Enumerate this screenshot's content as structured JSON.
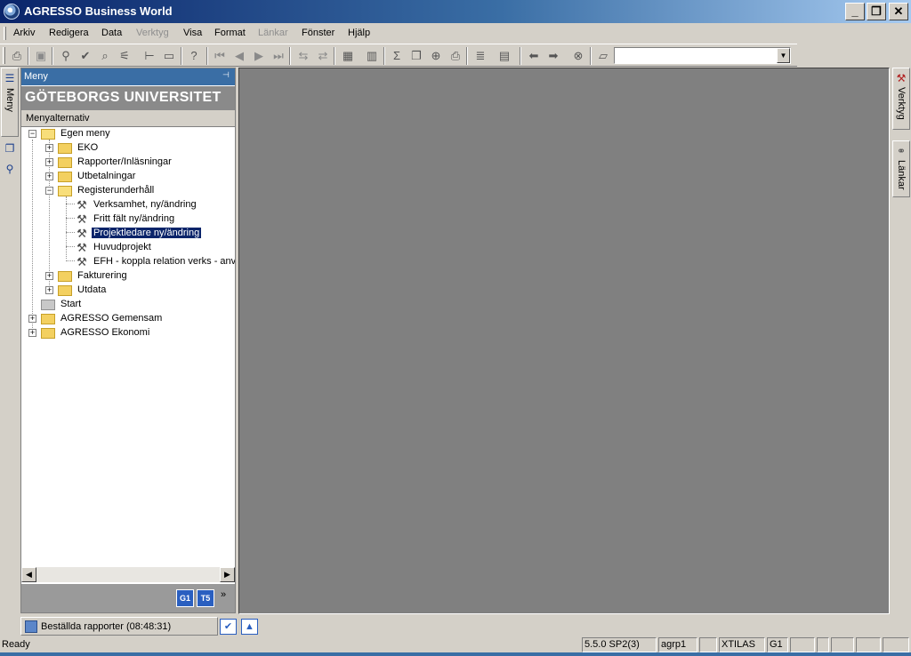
{
  "window": {
    "title": "AGRESSO Business World",
    "controls": {
      "minimize": "_",
      "restore": "❐",
      "close": "✕"
    }
  },
  "menubar": [
    {
      "label": "Arkiv",
      "enabled": true
    },
    {
      "label": "Redigera",
      "enabled": true
    },
    {
      "label": "Data",
      "enabled": true
    },
    {
      "label": "Verktyg",
      "enabled": false
    },
    {
      "label": "Visa",
      "enabled": true
    },
    {
      "label": "Format",
      "enabled": true
    },
    {
      "label": "Länkar",
      "enabled": false
    },
    {
      "label": "Fönster",
      "enabled": true
    },
    {
      "label": "Hjälp",
      "enabled": true
    }
  ],
  "toolbar": {
    "icons": [
      "print-icon",
      "save-icon",
      "find-icon",
      "check-icon",
      "search-icon",
      "filter-icon",
      "insert-row-icon",
      "delete-row-icon",
      "help-icon",
      "first-icon",
      "previous-icon",
      "next-icon",
      "last-icon",
      "export-icon",
      "import-icon",
      "table-icon",
      "chart-icon",
      "sum-icon",
      "copy-icon",
      "zoom-icon",
      "print-preview-icon",
      "layers-icon",
      "clipboard-icon",
      "back-icon",
      "forward-icon",
      "stop-icon",
      "open-icon"
    ],
    "combo_value": ""
  },
  "left_tabs": {
    "menu_tab": "Meny"
  },
  "right_tabs": {
    "tools_tab": "Verktyg",
    "links_tab": "Länkar"
  },
  "panel": {
    "caption": "Meny",
    "banner": "GÖTEBORGS UNIVERSITET",
    "subheading": "Menyalternativ",
    "tree": [
      {
        "label": "Egen meny",
        "level": 0,
        "type": "folder-open",
        "expander": "−"
      },
      {
        "label": "EKO",
        "level": 1,
        "type": "folder",
        "expander": "+"
      },
      {
        "label": "Rapporter/Inläsningar",
        "level": 1,
        "type": "folder",
        "expander": "+"
      },
      {
        "label": "Utbetalningar",
        "level": 1,
        "type": "folder",
        "expander": "+"
      },
      {
        "label": "Registerunderhåll",
        "level": 1,
        "type": "folder-open",
        "expander": "−"
      },
      {
        "label": "Verksamhet, ny/ändring",
        "level": 2,
        "type": "tool",
        "expander": ""
      },
      {
        "label": "Fritt fält ny/ändring",
        "level": 2,
        "type": "tool",
        "expander": ""
      },
      {
        "label": "Projektledare ny/ändring",
        "level": 2,
        "type": "tool",
        "expander": "",
        "selected": true
      },
      {
        "label": "Huvudprojekt",
        "level": 2,
        "type": "tool",
        "expander": ""
      },
      {
        "label": "EFH - koppla relation verks - anv",
        "level": 2,
        "type": "tool",
        "expander": ""
      },
      {
        "label": "Fakturering",
        "level": 1,
        "type": "folder",
        "expander": "+"
      },
      {
        "label": "Utdata",
        "level": 1,
        "type": "folder",
        "expander": "+"
      },
      {
        "label": "Start",
        "level": 0,
        "type": "folder-grey",
        "expander": ""
      },
      {
        "label": "AGRESSO Gemensam",
        "level": 0,
        "type": "folder",
        "expander": "+"
      },
      {
        "label": "AGRESSO Ekonomi",
        "level": 0,
        "type": "folder",
        "expander": "+"
      }
    ],
    "footer_buttons": [
      "G1",
      "T5"
    ]
  },
  "taskbar": {
    "item_label": "Beställda rapporter (08:48:31)"
  },
  "statusbar": {
    "status": "Ready",
    "fields": [
      "5.5.0 SP2(3)",
      "agrp1",
      "",
      "XTILAS",
      "G1",
      "",
      "",
      "",
      "",
      ""
    ]
  }
}
